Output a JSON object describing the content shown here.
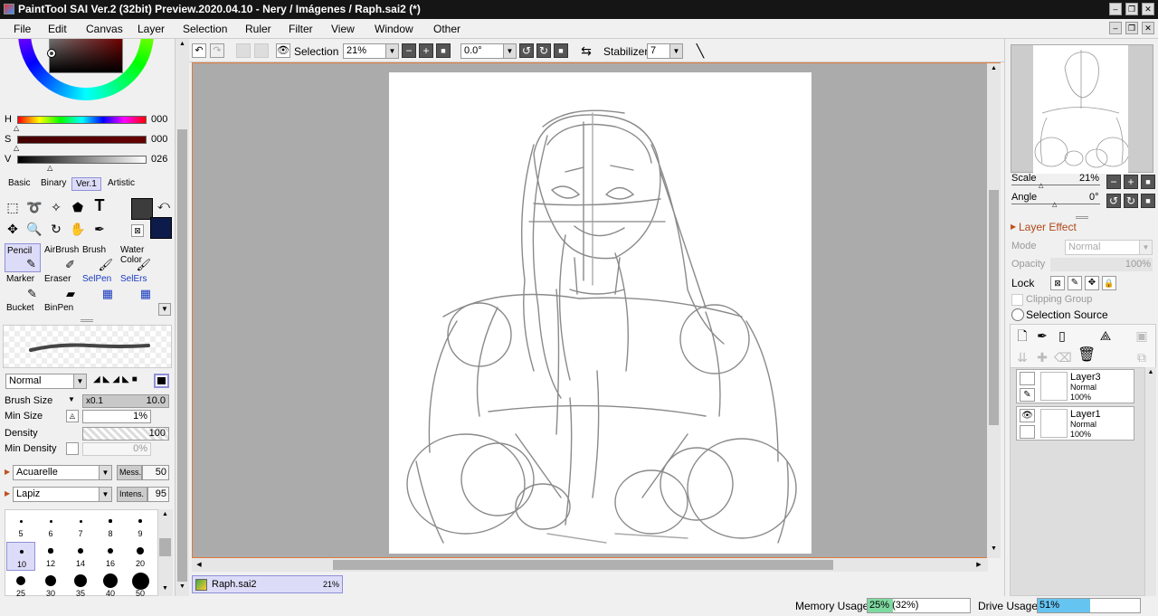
{
  "window": {
    "title": "PaintTool SAI Ver.2 (32bit) Preview.2020.04.10 - Nery / Imágenes / Raph.sai2 (*)",
    "min": "–",
    "max": "❐",
    "close": "✕"
  },
  "menu": [
    "File",
    "Edit",
    "Canvas",
    "Layer",
    "Selection",
    "Ruler",
    "Filter",
    "View",
    "Window",
    "Other"
  ],
  "color": {
    "h_label": "H",
    "h_value": "000",
    "s_label": "S",
    "s_value": "000",
    "v_label": "V",
    "v_value": "026",
    "h_level": 0,
    "s_level": 0,
    "v_level": 0.26,
    "tabs": [
      "Basic",
      "Binary",
      "Ver.1",
      "Artistic"
    ],
    "active_tab": "Ver.1",
    "primary": "#3c3c3c",
    "secondary": "#0d1b4a"
  },
  "tools": [
    {
      "label": "Pencil",
      "icon": "✎",
      "sel": true,
      "blue": false
    },
    {
      "label": "AirBrush",
      "icon": "✐",
      "sel": false,
      "blue": false
    },
    {
      "label": "Brush",
      "icon": "🖌",
      "sel": false,
      "blue": false
    },
    {
      "label": "Water Color",
      "icon": "🖌",
      "sel": false,
      "blue": false
    },
    {
      "label": "Marker",
      "icon": "✎",
      "sel": false,
      "blue": false
    },
    {
      "label": "Eraser",
      "icon": "▰",
      "sel": false,
      "blue": false
    },
    {
      "label": "SelPen",
      "icon": "▦",
      "sel": false,
      "blue": true
    },
    {
      "label": "SelErs",
      "icon": "▦",
      "sel": false,
      "blue": true
    },
    {
      "label": "Bucket",
      "icon": "",
      "sel": false,
      "blue": false
    },
    {
      "label": "BinPen",
      "icon": "",
      "sel": false,
      "blue": false
    }
  ],
  "brush": {
    "blend_mode": "Normal",
    "size_label": "Brush Size",
    "size_mult": "x0.1",
    "size_value": "10.0",
    "min_size_label": "Min Size",
    "min_size_value": "1%",
    "density_label": "Density",
    "density_value": "100",
    "min_density_label": "Min Density",
    "min_density_value": "0%",
    "texture1": "Acuarelle",
    "texture1_param": "Mess.",
    "texture1_value": "50",
    "texture2": "Lapiz",
    "texture2_param": "Intens.",
    "texture2_value": "95",
    "sizes": [
      "5",
      "6",
      "7",
      "8",
      "9",
      "10",
      "12",
      "14",
      "16",
      "20",
      "25",
      "30",
      "35",
      "40",
      "50"
    ],
    "selected_size": "10"
  },
  "toolbar": {
    "selection_label": "Selection",
    "zoom": "21%",
    "angle": "0.0°",
    "stabilizer_label": "Stabilizer",
    "stabilizer_value": "7"
  },
  "navigator": {
    "scale_label": "Scale",
    "scale_value": "21%",
    "angle_label": "Angle",
    "angle_value": "0°"
  },
  "layer_panel": {
    "effect_label": "Layer Effect",
    "mode_label": "Mode",
    "mode_value": "Normal",
    "opacity_label": "Opacity",
    "opacity_value": "100%",
    "lock_label": "Lock",
    "clipping_label": "Clipping Group",
    "selection_source_label": "Selection Source"
  },
  "layers": [
    {
      "name": "Layer3",
      "mode": "Normal",
      "opacity": "100%",
      "selected": true,
      "visible": false
    },
    {
      "name": "Layer1",
      "mode": "Normal",
      "opacity": "100%",
      "selected": false,
      "visible": true
    }
  ],
  "document_tab": {
    "name": "Raph.sai2",
    "zoom": "21%"
  },
  "status": {
    "memory_label": "Memory Usage",
    "memory_value": "25% (32%)",
    "memory_level": 0.25,
    "drive_label": "Drive Usage",
    "drive_value": "51%",
    "drive_level": 0.51
  }
}
